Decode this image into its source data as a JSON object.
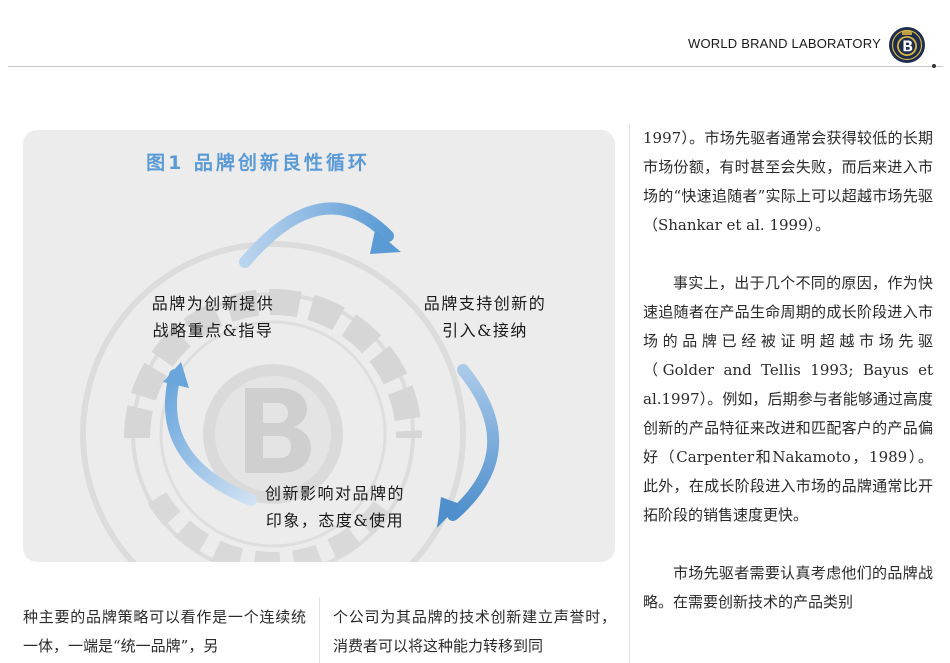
{
  "header": {
    "brand": "WORLD BRAND LABORATORY"
  },
  "figure": {
    "title": "图1 品牌创新良性循环",
    "labels": {
      "left_line1": "品牌为创新提供",
      "left_line2": "战略重点&指导",
      "right_line1": "品牌支持创新的",
      "right_line2": "引入&接纳",
      "bottom_line1": "创新影响对品牌的",
      "bottom_line2": "印象，态度&使用"
    },
    "arrow_color": "#5b9bd5"
  },
  "right_column": {
    "para1": "1997）。市场先驱者通常会获得较低的长期市场份额，有时甚至会失败，而后来进入市场的“快速追随者”实际上可以超越市场先驱（Shankar et al. 1999）。",
    "para2": "事实上，出于几个不同的原因，作为快速追随者在产品生命周期的成长阶段进入市场的品牌已经被证明超越市场先驱（Golder and Tellis 1993; Bayus et al.1997）。例如，后期参与者能够通过高度创新的产品特征来改进和匹配客户的产品偏好（Carpenter和Nakamoto，1989）。此外，在成长阶段进入市场的品牌通常比开拓阶段的销售速度更快。",
    "para3": "市场先驱者需要认真考虑他们的品牌战略。在需要创新技术的产品类别"
  },
  "bottom": {
    "left": "种主要的品牌策略可以看作是一个连续统一体，一端是“统一品牌”，另",
    "middle": "个公司为其品牌的技术创新建立声誉时，消费者可以将这种能力转移到同"
  },
  "colors": {
    "panel_bg": "#ececec",
    "title_blue": "#5b9bd5",
    "logo_navy": "#1c2d4f",
    "logo_gold": "#d8b341"
  }
}
